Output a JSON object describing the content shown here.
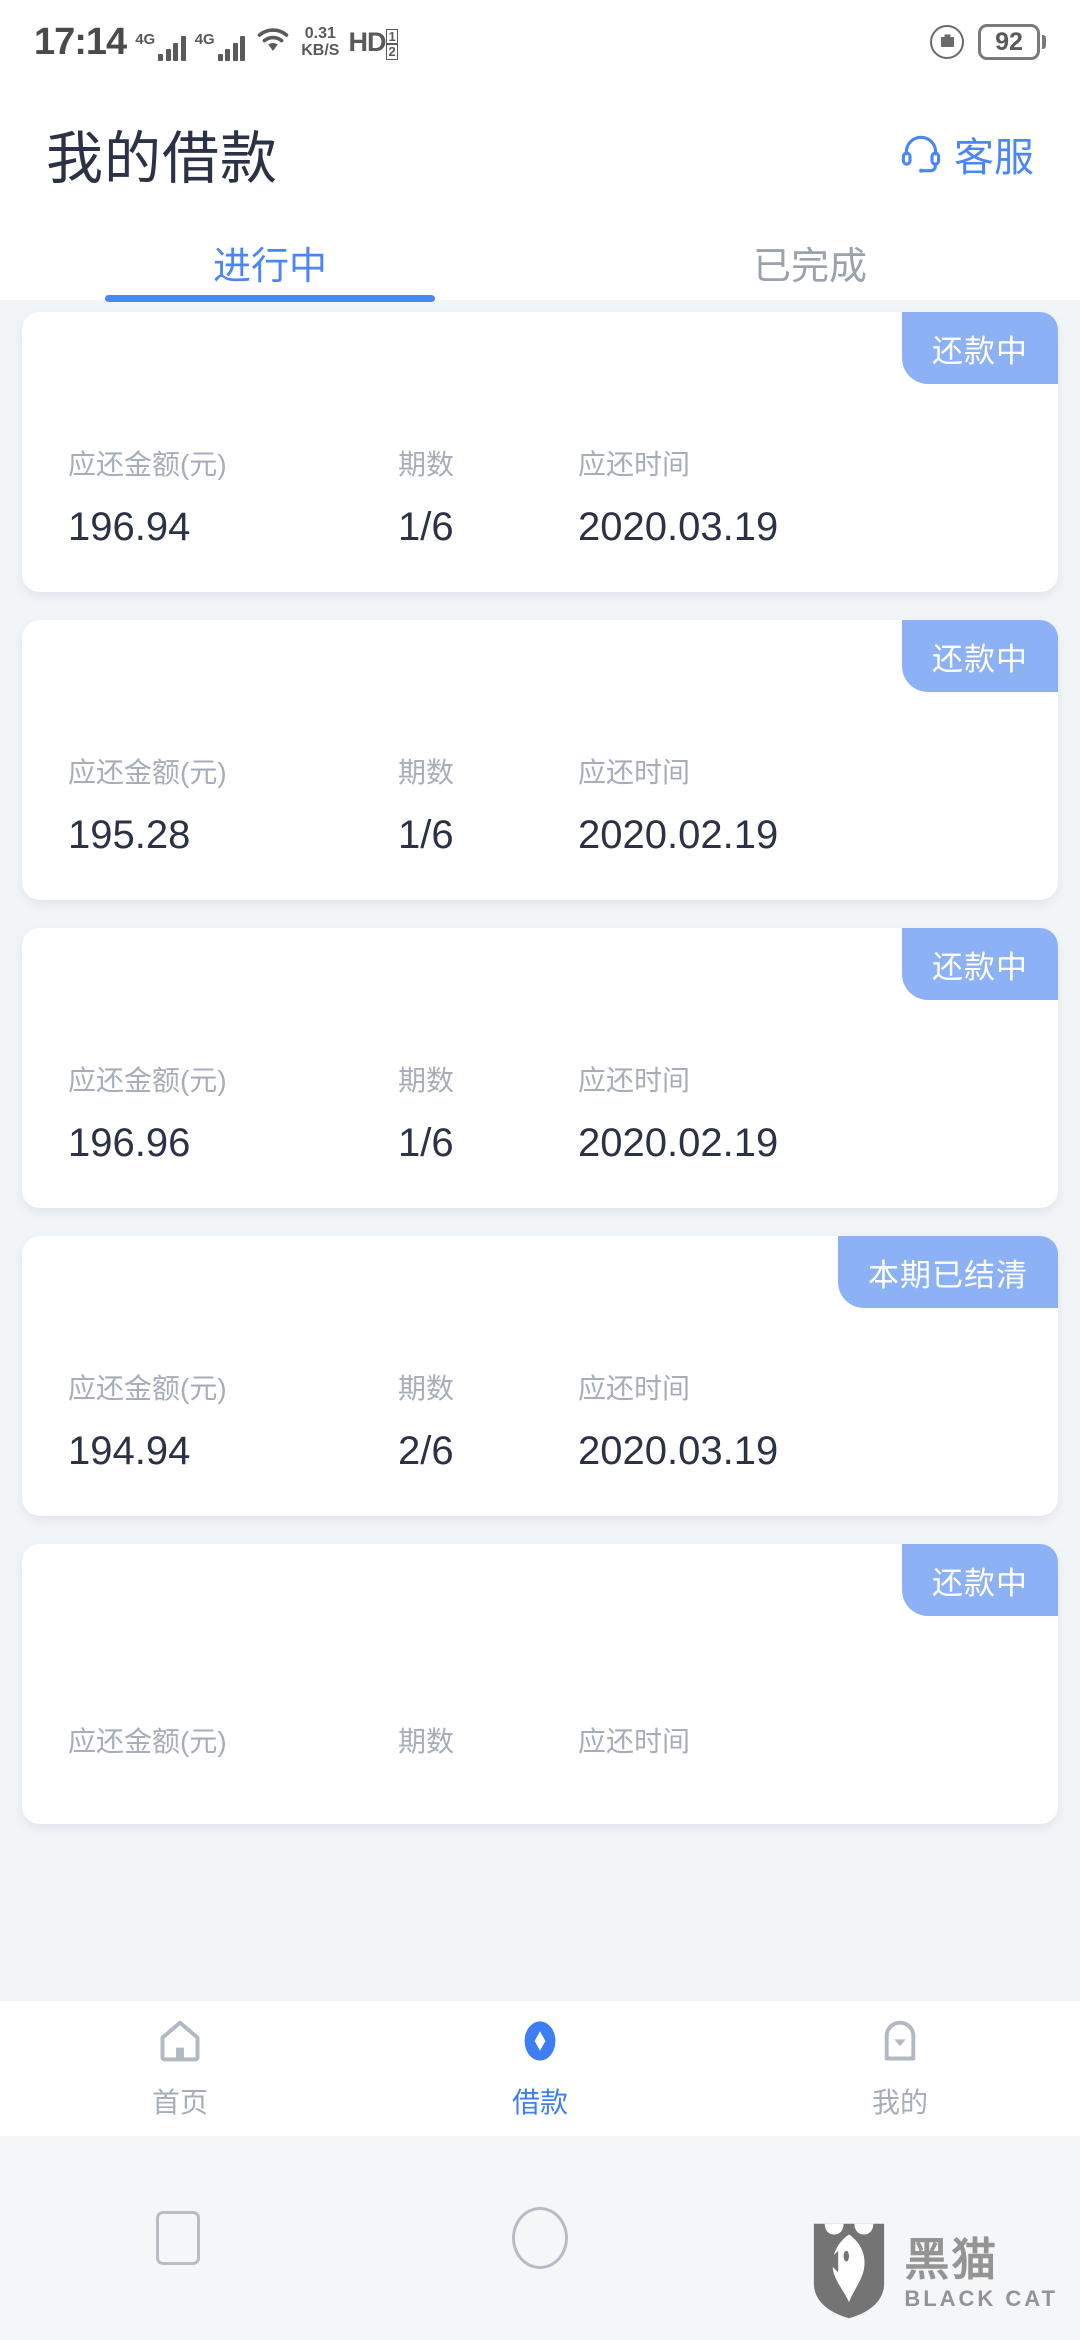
{
  "status_bar": {
    "time": "17:14",
    "network_1": "4G",
    "network_2": "4G",
    "data_rate_value": "0.31",
    "data_rate_unit": "KB/S",
    "hd_label": "HD",
    "hd_num_1": "1",
    "hd_num_2": "2",
    "battery": "92"
  },
  "header": {
    "title": "我的借款",
    "customer_service_label": "客服"
  },
  "tabs": [
    {
      "label": "进行中",
      "active": true
    },
    {
      "label": "已完成",
      "active": false
    }
  ],
  "card_labels": {
    "amount": "应还金额(元)",
    "period": "期数",
    "due_date": "应还时间"
  },
  "loans": [
    {
      "status": "还款中",
      "amount": "196.94",
      "period": "1/6",
      "due_date": "2020.03.19"
    },
    {
      "status": "还款中",
      "amount": "195.28",
      "period": "1/6",
      "due_date": "2020.02.19"
    },
    {
      "status": "还款中",
      "amount": "196.96",
      "period": "1/6",
      "due_date": "2020.02.19"
    },
    {
      "status": "本期已结清",
      "amount": "194.94",
      "period": "2/6",
      "due_date": "2020.03.19"
    },
    {
      "status": "还款中",
      "amount": "",
      "period": "",
      "due_date": ""
    }
  ],
  "bottom_nav": [
    {
      "label": "首页",
      "icon": "home-icon",
      "active": false
    },
    {
      "label": "借款",
      "icon": "loan-icon",
      "active": true
    },
    {
      "label": "我的",
      "icon": "user-icon",
      "active": false
    }
  ],
  "watermark": {
    "cn": "黑猫",
    "en": "BLACK CAT"
  },
  "colors": {
    "accent": "#4a86f7",
    "badge": "#8cb2f5",
    "text_primary": "#2b3245",
    "text_muted": "#a7aeb9",
    "page_bg": "#f2f5f8"
  }
}
